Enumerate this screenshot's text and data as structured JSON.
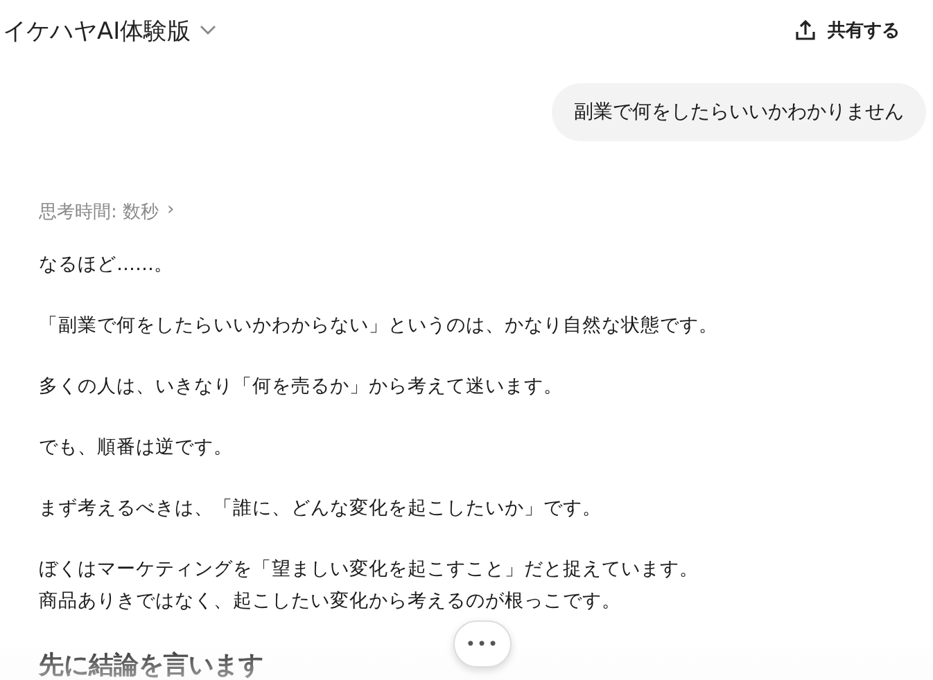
{
  "header": {
    "title": "イケハヤAI体験版",
    "share": "共有する"
  },
  "user_message": "副業で何をしたらいいかわかりません",
  "thinking": {
    "label": "思考時間: 数秒",
    "chevron": "›"
  },
  "paragraphs": [
    {
      "lines": [
        "なるほど……。"
      ]
    },
    {
      "lines": [
        "「副業で何をしたらいいかわからない」というのは、かなり自然な状態です。"
      ]
    },
    {
      "lines": [
        "多くの人は、いきなり「何を売るか」から考えて迷います。"
      ]
    },
    {
      "lines": [
        "でも、順番は逆です。"
      ]
    },
    {
      "lines": [
        "まず考えるべきは、「誰に、どんな変化を起こしたいか」です。"
      ]
    },
    {
      "lines": [
        "ぼくはマーケティングを「望ましい変化を起こすこと」だと捉えています。",
        "商品ありきではなく、起こしたい変化から考えるのが根っこです。"
      ]
    }
  ],
  "heading": "先に結論を言います",
  "more_button": "•••"
}
